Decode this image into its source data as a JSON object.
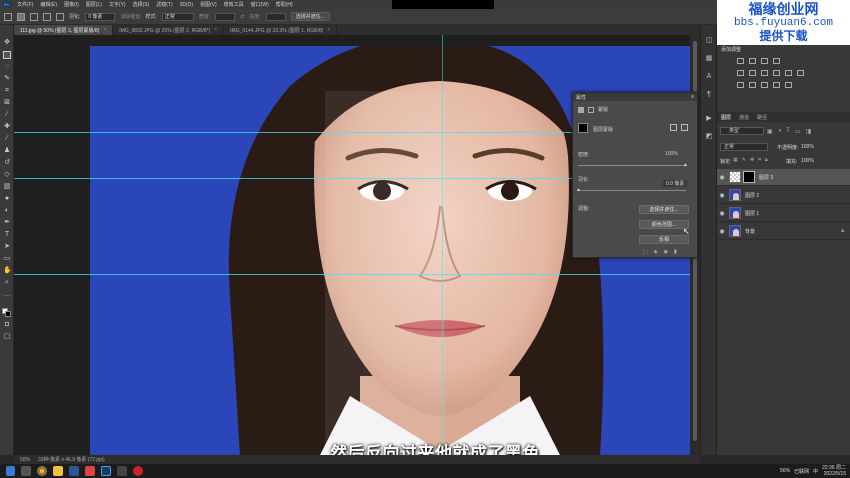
{
  "menu": {
    "items": [
      "文件(F)",
      "编辑(E)",
      "图像(I)",
      "图层(L)",
      "文字(Y)",
      "选择(S)",
      "滤镜(T)",
      "3D(D)",
      "视图(V)",
      "增效工具",
      "窗口(W)",
      "帮助(H)"
    ]
  },
  "options": {
    "feather_label": "羽化:",
    "feather_value": "0 像素",
    "antialias_label": "消除锯齿",
    "style_label": "样式:",
    "style_value": "正常",
    "width_label": "宽度:",
    "height_label": "高度:",
    "select_mask_button": "选择并遮住..."
  },
  "tabs": [
    {
      "label": "111.jpg @ 50% (图层 3, 图层蒙版/8)",
      "active": true
    },
    {
      "label": "IMG_9832.JPG @ 25% (图层 2, RGB/8*)",
      "active": false
    },
    {
      "label": "IMG_0144.JPG @ 33.3% (图层 1, RGB/8)",
      "active": false
    }
  ],
  "tab_close": "×",
  "statusbar": {
    "zoom": "50%",
    "doc_size": "33种 像素 x 46.9 像素 (72 ppi)"
  },
  "subtitle": "然后反向过来他就成了黑色",
  "properties": {
    "title": "属性",
    "menu_glyph": "≡",
    "tab_label": "蒙版",
    "mask_type": "图层蒙版",
    "density_label": "密度:",
    "density_value": "100%",
    "feather_label": "羽化:",
    "feather_value": "0.0 像素",
    "adjust_label": "调整:",
    "btn_select_mask": "选择并遮住...",
    "btn_color_range": "颜色范围...",
    "btn_invert": "反相"
  },
  "watermark": {
    "line1": "福缘创业网",
    "line2": "bbs.fuyuan6.com",
    "line3": "提供下载"
  },
  "adjustments": {
    "title": "添加调整"
  },
  "layers_panel": {
    "tabs": [
      "图层",
      "通道",
      "路径"
    ],
    "filter_label": "类型",
    "blend_mode": "正常",
    "opacity_label": "不透明度:",
    "opacity_value": "100%",
    "lock_label": "锁定:",
    "fill_label": "填充:",
    "fill_value": "100%",
    "layers": [
      {
        "name": "图层 3",
        "has_mask": true,
        "selected": true
      },
      {
        "name": "图层 2",
        "has_mask": false,
        "selected": false
      },
      {
        "name": "图层 1",
        "has_mask": false,
        "selected": false
      },
      {
        "name": "背景",
        "has_mask": false,
        "selected": false,
        "locked": true
      }
    ]
  },
  "taskbar": {
    "ime": "中",
    "volume": "56%",
    "network": "已联网",
    "time": "22:36 周二",
    "date": "2022/5/15"
  },
  "colors": {
    "photo_background": "#2b46b8",
    "guide": "#3fe3ff",
    "watermark_text": "#1a52c9"
  }
}
